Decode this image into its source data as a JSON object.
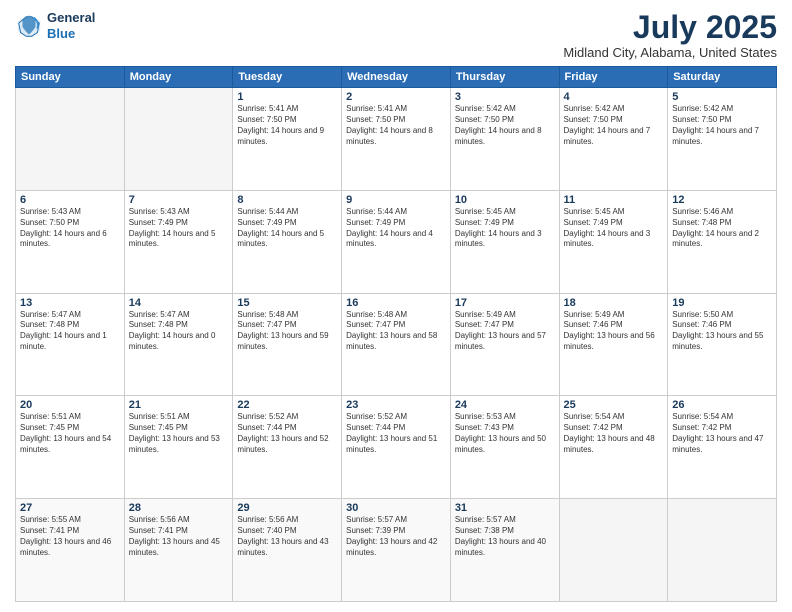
{
  "header": {
    "logo_line1": "General",
    "logo_line2": "Blue",
    "month_title": "July 2025",
    "location": "Midland City, Alabama, United States"
  },
  "days_of_week": [
    "Sunday",
    "Monday",
    "Tuesday",
    "Wednesday",
    "Thursday",
    "Friday",
    "Saturday"
  ],
  "weeks": [
    [
      {
        "day": "",
        "info": ""
      },
      {
        "day": "",
        "info": ""
      },
      {
        "day": "1",
        "info": "Sunrise: 5:41 AM\nSunset: 7:50 PM\nDaylight: 14 hours and 9 minutes."
      },
      {
        "day": "2",
        "info": "Sunrise: 5:41 AM\nSunset: 7:50 PM\nDaylight: 14 hours and 8 minutes."
      },
      {
        "day": "3",
        "info": "Sunrise: 5:42 AM\nSunset: 7:50 PM\nDaylight: 14 hours and 8 minutes."
      },
      {
        "day": "4",
        "info": "Sunrise: 5:42 AM\nSunset: 7:50 PM\nDaylight: 14 hours and 7 minutes."
      },
      {
        "day": "5",
        "info": "Sunrise: 5:42 AM\nSunset: 7:50 PM\nDaylight: 14 hours and 7 minutes."
      }
    ],
    [
      {
        "day": "6",
        "info": "Sunrise: 5:43 AM\nSunset: 7:50 PM\nDaylight: 14 hours and 6 minutes."
      },
      {
        "day": "7",
        "info": "Sunrise: 5:43 AM\nSunset: 7:49 PM\nDaylight: 14 hours and 5 minutes."
      },
      {
        "day": "8",
        "info": "Sunrise: 5:44 AM\nSunset: 7:49 PM\nDaylight: 14 hours and 5 minutes."
      },
      {
        "day": "9",
        "info": "Sunrise: 5:44 AM\nSunset: 7:49 PM\nDaylight: 14 hours and 4 minutes."
      },
      {
        "day": "10",
        "info": "Sunrise: 5:45 AM\nSunset: 7:49 PM\nDaylight: 14 hours and 3 minutes."
      },
      {
        "day": "11",
        "info": "Sunrise: 5:45 AM\nSunset: 7:49 PM\nDaylight: 14 hours and 3 minutes."
      },
      {
        "day": "12",
        "info": "Sunrise: 5:46 AM\nSunset: 7:48 PM\nDaylight: 14 hours and 2 minutes."
      }
    ],
    [
      {
        "day": "13",
        "info": "Sunrise: 5:47 AM\nSunset: 7:48 PM\nDaylight: 14 hours and 1 minute."
      },
      {
        "day": "14",
        "info": "Sunrise: 5:47 AM\nSunset: 7:48 PM\nDaylight: 14 hours and 0 minutes."
      },
      {
        "day": "15",
        "info": "Sunrise: 5:48 AM\nSunset: 7:47 PM\nDaylight: 13 hours and 59 minutes."
      },
      {
        "day": "16",
        "info": "Sunrise: 5:48 AM\nSunset: 7:47 PM\nDaylight: 13 hours and 58 minutes."
      },
      {
        "day": "17",
        "info": "Sunrise: 5:49 AM\nSunset: 7:47 PM\nDaylight: 13 hours and 57 minutes."
      },
      {
        "day": "18",
        "info": "Sunrise: 5:49 AM\nSunset: 7:46 PM\nDaylight: 13 hours and 56 minutes."
      },
      {
        "day": "19",
        "info": "Sunrise: 5:50 AM\nSunset: 7:46 PM\nDaylight: 13 hours and 55 minutes."
      }
    ],
    [
      {
        "day": "20",
        "info": "Sunrise: 5:51 AM\nSunset: 7:45 PM\nDaylight: 13 hours and 54 minutes."
      },
      {
        "day": "21",
        "info": "Sunrise: 5:51 AM\nSunset: 7:45 PM\nDaylight: 13 hours and 53 minutes."
      },
      {
        "day": "22",
        "info": "Sunrise: 5:52 AM\nSunset: 7:44 PM\nDaylight: 13 hours and 52 minutes."
      },
      {
        "day": "23",
        "info": "Sunrise: 5:52 AM\nSunset: 7:44 PM\nDaylight: 13 hours and 51 minutes."
      },
      {
        "day": "24",
        "info": "Sunrise: 5:53 AM\nSunset: 7:43 PM\nDaylight: 13 hours and 50 minutes."
      },
      {
        "day": "25",
        "info": "Sunrise: 5:54 AM\nSunset: 7:42 PM\nDaylight: 13 hours and 48 minutes."
      },
      {
        "day": "26",
        "info": "Sunrise: 5:54 AM\nSunset: 7:42 PM\nDaylight: 13 hours and 47 minutes."
      }
    ],
    [
      {
        "day": "27",
        "info": "Sunrise: 5:55 AM\nSunset: 7:41 PM\nDaylight: 13 hours and 46 minutes."
      },
      {
        "day": "28",
        "info": "Sunrise: 5:56 AM\nSunset: 7:41 PM\nDaylight: 13 hours and 45 minutes."
      },
      {
        "day": "29",
        "info": "Sunrise: 5:56 AM\nSunset: 7:40 PM\nDaylight: 13 hours and 43 minutes."
      },
      {
        "day": "30",
        "info": "Sunrise: 5:57 AM\nSunset: 7:39 PM\nDaylight: 13 hours and 42 minutes."
      },
      {
        "day": "31",
        "info": "Sunrise: 5:57 AM\nSunset: 7:38 PM\nDaylight: 13 hours and 40 minutes."
      },
      {
        "day": "",
        "info": ""
      },
      {
        "day": "",
        "info": ""
      }
    ]
  ]
}
